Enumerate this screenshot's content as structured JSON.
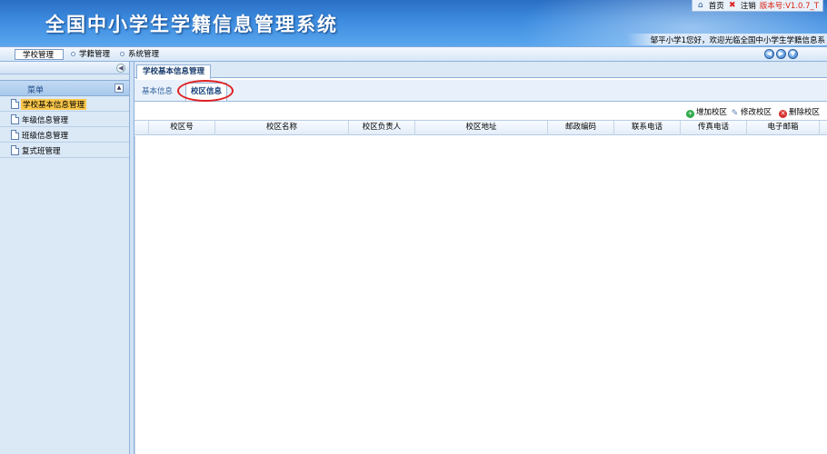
{
  "header": {
    "system_title": "全国中小学生学籍信息管理系统",
    "top_links": {
      "home": "首页",
      "logout": "注销",
      "version": "版本号:V1.0.7_T"
    },
    "welcome": "邹平小学1您好，欢迎光临全国中小学生学籍信息系"
  },
  "nav": {
    "items": [
      {
        "label": "学校管理"
      },
      {
        "label": "学籍管理"
      },
      {
        "label": "系统管理"
      }
    ]
  },
  "sidebar": {
    "menu_title": "菜单",
    "items": [
      {
        "label": "学校基本信息管理"
      },
      {
        "label": "年级信息管理"
      },
      {
        "label": "班级信息管理"
      },
      {
        "label": "复式班管理"
      }
    ]
  },
  "main": {
    "tab_title": "学校基本信息管理",
    "sub_tabs": [
      {
        "label": "基本信息"
      },
      {
        "label": "校区信息"
      }
    ],
    "toolbar": {
      "add": "增加校区",
      "edit": "修改校区",
      "delete": "删除校区"
    },
    "columns": [
      "校区号",
      "校区名称",
      "校区负责人",
      "校区地址",
      "邮政编码",
      "联系电话",
      "传真电话",
      "电子邮箱"
    ]
  },
  "colors": {
    "accent": "#3d8ce0",
    "active_menu": "#fbc84a",
    "highlight_oval": "#e02020"
  }
}
